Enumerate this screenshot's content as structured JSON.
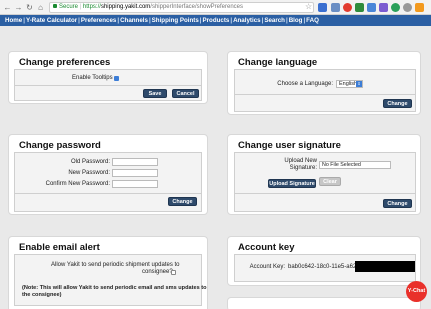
{
  "browser": {
    "secure_label": "Secure",
    "url_scheme": "https://",
    "url_host": "shipping.yakit.com",
    "url_path": "/shipperInterface/showPreferences"
  },
  "nav": {
    "items": [
      "Home",
      "Y-Rate Calculator",
      "Preferences",
      "Channels",
      "Shipping Points",
      "Products",
      "Analytics",
      "Search",
      "Blog",
      "FAQ"
    ],
    "separator": "|"
  },
  "preferences": {
    "title": "Change preferences",
    "enable_tooltips_label": "Enable Tooltips",
    "save_label": "Save",
    "cancel_label": "Cancel"
  },
  "language": {
    "title": "Change language",
    "choose_label": "Choose a Language:",
    "selected": "English",
    "change_label": "Change"
  },
  "password": {
    "title": "Change password",
    "old_label": "Old Password:",
    "new_label": "New Password:",
    "confirm_label": "Confirm New Password:",
    "change_label": "Change"
  },
  "signature": {
    "title": "Change user signature",
    "upload_label_1": "Upload New",
    "upload_label_2": "Signature:",
    "file_status": "No File Selected",
    "upload_button": "Upload Signature",
    "clear_button": "Clear",
    "change_label": "Change"
  },
  "email_alert": {
    "title": "Enable email alert",
    "question_1": "Allow Yakit to send periodic shipment updates to",
    "question_2": "consignee?",
    "note_1": "(Note: This will allow Yakit to send periodic email and sms updates to",
    "note_2": "the consignee)"
  },
  "account": {
    "title": "Account key",
    "key_label": "Account Key:",
    "key_value": "bab0c642-18c0-11e5-a623-"
  },
  "chat": {
    "label": "Y-Chat"
  }
}
